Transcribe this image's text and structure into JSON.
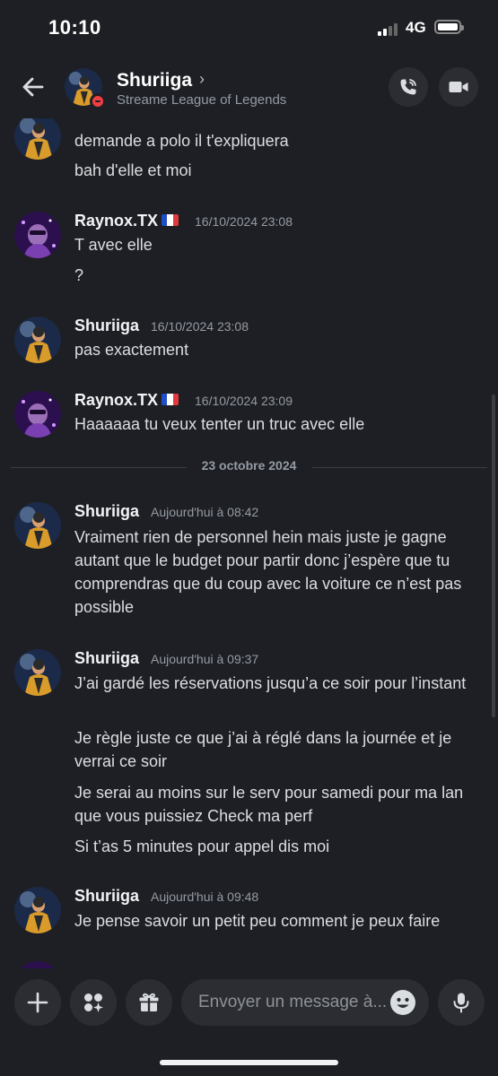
{
  "status_bar": {
    "time": "10:10",
    "network": "4G"
  },
  "header": {
    "name": "Shuriiga",
    "chevron": "›",
    "status": "Streame League of Legends"
  },
  "messages": [
    {
      "kind": "cont",
      "text": "demande a polo il t'expliquera"
    },
    {
      "kind": "cont",
      "text": "bah d'elle et moi"
    },
    {
      "kind": "head",
      "author": "Raynox.TX",
      "flag": "fr",
      "time": "16/10/2024 23:08",
      "text": "T avec elle"
    },
    {
      "kind": "cont",
      "text": "?"
    },
    {
      "kind": "head",
      "author": "Shuriiga",
      "time": "16/10/2024 23:08",
      "text": "pas exactement"
    },
    {
      "kind": "head",
      "author": "Raynox.TX",
      "flag": "fr",
      "time": "16/10/2024 23:09",
      "text": "Haaaaaa tu veux tenter un truc avec elle"
    },
    {
      "kind": "divider",
      "label": "23 octobre 2024"
    },
    {
      "kind": "head",
      "author": "Shuriiga",
      "time": "Aujourd'hui à 08:42",
      "text": "Vraiment rien de personnel hein mais juste je gagne autant que le budget pour partir donc j’espère que tu comprendras que du coup avec la voiture ce n’est pas possible"
    },
    {
      "kind": "head",
      "author": "Shuriiga",
      "time": "Aujourd'hui à 09:37",
      "text": "J’ai gardé les réservations jusqu’a ce soir pour l’instant"
    },
    {
      "kind": "cont",
      "text": "Je règle juste ce que j’ai à réglé dans la journée et je verrai ce soir"
    },
    {
      "kind": "cont",
      "text": "Je serai au moins sur le serv pour samedi pour ma lan que vous puissiez Check ma perf"
    },
    {
      "kind": "cont",
      "text": "Si t’as 5 minutes pour appel dis moi"
    },
    {
      "kind": "head",
      "author": "Shuriiga",
      "time": "Aujourd'hui à 09:48",
      "text": "Je pense savoir un petit peu comment je peux faire"
    }
  ],
  "composer": {
    "placeholder": "Envoyer un message à..."
  }
}
